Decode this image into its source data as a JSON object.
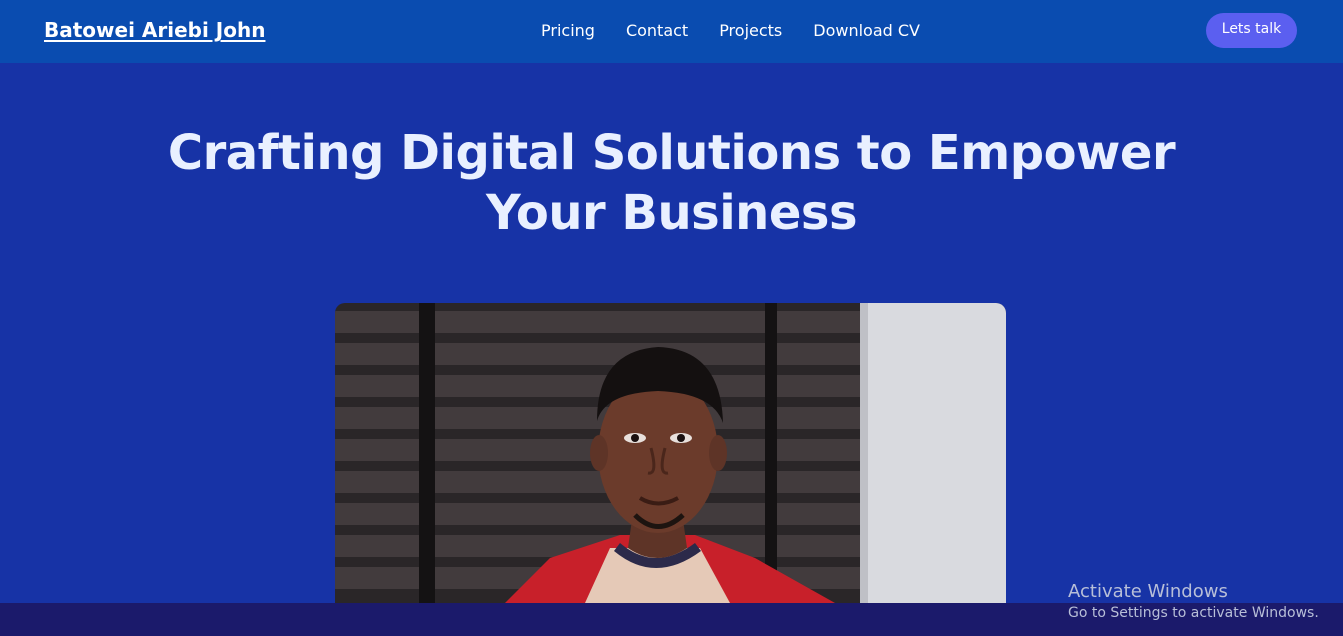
{
  "navbar": {
    "brand": "Batowei Ariebi John",
    "links": [
      "Pricing",
      "Contact",
      "Projects",
      "Download CV"
    ],
    "cta_label": "Lets talk"
  },
  "hero": {
    "title": "Crafting Digital Solutions to Empower Your Business",
    "photo": "portrait-photo"
  },
  "watermark": {
    "title": "Activate Windows",
    "subtitle": "Go to Settings to activate Windows."
  },
  "colors": {
    "navbar": "#0a4cb0",
    "hero_background": "#1733a6",
    "cta": "#5b5ff0",
    "title_text": "#e9f0ff",
    "bottom_bar": "#1b1a6b"
  }
}
